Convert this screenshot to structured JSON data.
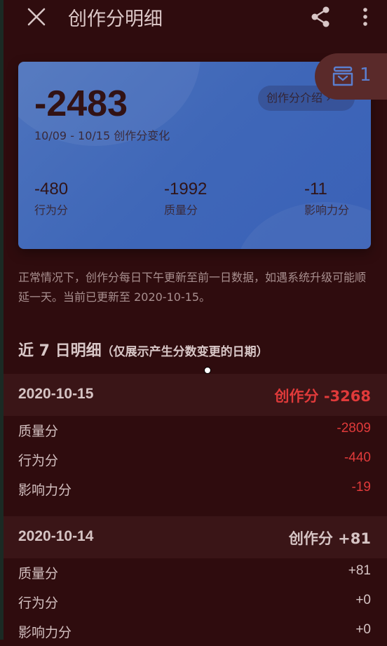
{
  "header": {
    "title": "创作分明细"
  },
  "card": {
    "total": "-2483",
    "date_range": "10/09 - 10/15 创作分变化",
    "intro_label": "创作分介绍 ›",
    "stats": [
      {
        "value": "-480",
        "label": "行为分"
      },
      {
        "value": "-1992",
        "label": "质量分"
      },
      {
        "value": "-11",
        "label": "影响力分"
      }
    ]
  },
  "badge": {
    "count": "1"
  },
  "notice": "正常情况下，创作分每日下午更新至前一日数据，如遇系统升级可能顺延一天。当前已更新至 2020-10-15。",
  "section": {
    "title": "近 7 日明细",
    "subtitle": "（仅展示产生分数变更的日期）"
  },
  "days": [
    {
      "date": "2020-10-15",
      "summary": "创作分 -3268",
      "summary_color": "#e03a3a",
      "rows": [
        {
          "label": "质量分",
          "value": "-2809",
          "color": "#e03a3a"
        },
        {
          "label": "行为分",
          "value": "-440",
          "color": "#e03a3a"
        },
        {
          "label": "影响力分",
          "value": "-19",
          "color": "#e03a3a"
        }
      ]
    },
    {
      "date": "2020-10-14",
      "summary": "创作分 +81",
      "summary_color": "#d6c4c4",
      "rows": [
        {
          "label": "质量分",
          "value": "+81",
          "color": "#d6c4c4"
        },
        {
          "label": "行为分",
          "value": "+0",
          "color": "#d6c4c4"
        },
        {
          "label": "影响力分",
          "value": "+0",
          "color": "#d6c4c4"
        }
      ]
    }
  ]
}
